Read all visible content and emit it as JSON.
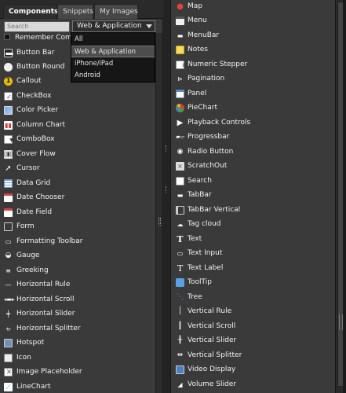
{
  "tabs": [
    {
      "label": "Components",
      "active": true
    },
    {
      "label": "Snippets",
      "active": false
    },
    {
      "label": "My Images",
      "active": false
    }
  ],
  "search": {
    "placeholder": "Search"
  },
  "platform_select": {
    "value": "Web & Application"
  },
  "remember_label": "Remember Com",
  "dropdown_options": [
    "All",
    "Web & Application",
    "iPhone/iPad",
    "Android"
  ],
  "left_items": [
    {
      "label": "Button Bar",
      "icon": "button-bar-icon"
    },
    {
      "label": "Button Round",
      "icon": "button-round-icon"
    },
    {
      "label": "Callout",
      "icon": "callout-icon"
    },
    {
      "label": "CheckBox",
      "icon": "checkbox-icon"
    },
    {
      "label": "Color Picker",
      "icon": "color-picker-icon"
    },
    {
      "label": "Column Chart",
      "icon": "column-chart-icon"
    },
    {
      "label": "ComboBox",
      "icon": "combobox-icon"
    },
    {
      "label": "Cover Flow",
      "icon": "cover-flow-icon"
    },
    {
      "label": "Cursor",
      "icon": "cursor-icon"
    },
    {
      "label": "Data Grid",
      "icon": "data-grid-icon"
    },
    {
      "label": "Date Chooser",
      "icon": "date-chooser-icon"
    },
    {
      "label": "Date Field",
      "icon": "date-field-icon"
    },
    {
      "label": "Form",
      "icon": "form-icon"
    },
    {
      "label": "Formatting Toolbar",
      "icon": "formatting-toolbar-icon"
    },
    {
      "label": "Gauge",
      "icon": "gauge-icon"
    },
    {
      "label": "Greeking",
      "icon": "greeking-icon"
    },
    {
      "label": "Horizontal Rule",
      "icon": "horizontal-rule-icon"
    },
    {
      "label": "Horizontal Scroll",
      "icon": "horizontal-scroll-icon"
    },
    {
      "label": "Horizontal Slider",
      "icon": "horizontal-slider-icon"
    },
    {
      "label": "Horizontal Splitter",
      "icon": "horizontal-splitter-icon"
    },
    {
      "label": "Hotspot",
      "icon": "hotspot-icon"
    },
    {
      "label": "Icon",
      "icon": "icon-icon"
    },
    {
      "label": "Image Placeholder",
      "icon": "image-placeholder-icon"
    },
    {
      "label": "LineChart",
      "icon": "line-chart-icon"
    }
  ],
  "right_items": [
    {
      "label": "Map",
      "icon": "map-pin-icon"
    },
    {
      "label": "Menu",
      "icon": "menu-icon"
    },
    {
      "label": "MenuBar",
      "icon": "menubar-icon"
    },
    {
      "label": "Notes",
      "icon": "notes-icon"
    },
    {
      "label": "Numeric Stepper",
      "icon": "numeric-stepper-icon"
    },
    {
      "label": "Pagination",
      "icon": "pagination-icon"
    },
    {
      "label": "Panel",
      "icon": "panel-icon"
    },
    {
      "label": "PieChart",
      "icon": "pie-chart-icon"
    },
    {
      "label": "Playback Controls",
      "icon": "playback-controls-icon"
    },
    {
      "label": "Progressbar",
      "icon": "progressbar-icon"
    },
    {
      "label": "Radio Button",
      "icon": "radio-button-icon"
    },
    {
      "label": "ScratchOut",
      "icon": "scratchout-icon"
    },
    {
      "label": "Search",
      "icon": "search-icon"
    },
    {
      "label": "TabBar",
      "icon": "tabbar-icon"
    },
    {
      "label": "TabBar Vertical",
      "icon": "tabbar-vertical-icon"
    },
    {
      "label": "Tag cloud",
      "icon": "tag-cloud-icon"
    },
    {
      "label": "Text",
      "icon": "text-icon"
    },
    {
      "label": "Text Input",
      "icon": "text-input-icon"
    },
    {
      "label": "Text Label",
      "icon": "text-label-icon"
    },
    {
      "label": "ToolTip",
      "icon": "tooltip-icon"
    },
    {
      "label": "Tree",
      "icon": "tree-icon"
    },
    {
      "label": "Vertical Rule",
      "icon": "vertical-rule-icon"
    },
    {
      "label": "Vertical Scroll",
      "icon": "vertical-scroll-icon"
    },
    {
      "label": "Vertical Slider",
      "icon": "vertical-slider-icon"
    },
    {
      "label": "Vertical Splitter",
      "icon": "vertical-splitter-icon"
    },
    {
      "label": "Video Display",
      "icon": "video-display-icon"
    },
    {
      "label": "Volume Slider",
      "icon": "volume-slider-icon"
    }
  ],
  "colors": {
    "panel_bg": "#3a3a3a",
    "accent_blue": "#5aa0e6",
    "callout_yellow": "#e8c000",
    "map_red": "#e04040"
  }
}
